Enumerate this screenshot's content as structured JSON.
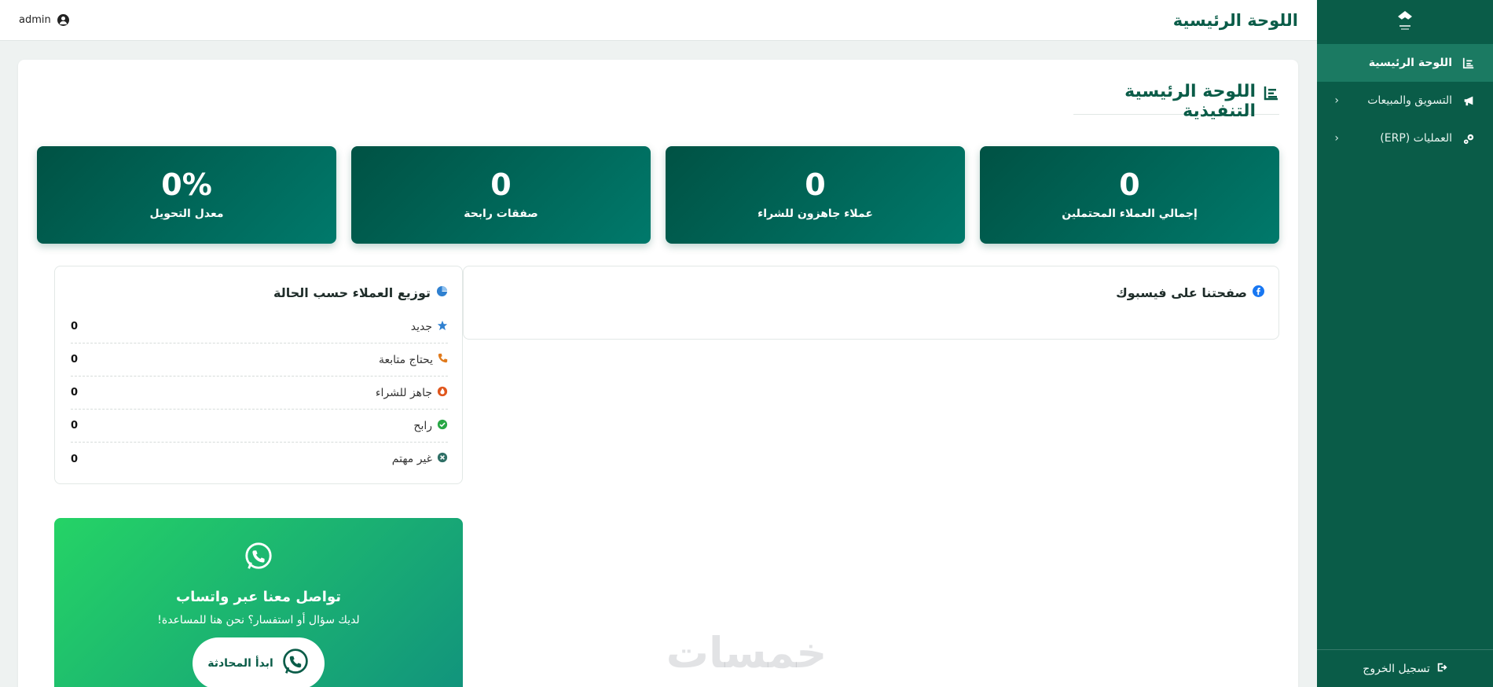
{
  "sidebar": {
    "items": [
      {
        "label": "اللوحة الرئيسية",
        "icon": "chart-icon",
        "active": true
      },
      {
        "label": "التسويق والمبيعات",
        "icon": "megaphone-icon"
      },
      {
        "label": "العمليات (ERP)",
        "icon": "gears-icon"
      }
    ],
    "logout_label": "تسجيل الخروج"
  },
  "header": {
    "title": "اللوحة الرئيسية",
    "user": "admin"
  },
  "main": {
    "section_title": "اللوحة الرئيسية التنفيذية",
    "stats": [
      {
        "value": "0",
        "label": "إجمالي العملاء المحتملين"
      },
      {
        "value": "0",
        "label": "عملاء جاهزون للشراء"
      },
      {
        "value": "0",
        "label": "صفقات رابحة"
      },
      {
        "value": "0%",
        "label": "معدل التحويل"
      }
    ],
    "facebook": {
      "title": "صفحتنا على فيسبوك"
    },
    "distribution": {
      "title": "توزيع العملاء حسب الحالة",
      "rows": [
        {
          "label": "جديد",
          "count": "0",
          "icon": "star-icon",
          "color": "#2f80d0"
        },
        {
          "label": "يحتاج متابعة",
          "count": "0",
          "icon": "phone-icon",
          "color": "#e07a1c"
        },
        {
          "label": "جاهز للشراء",
          "count": "0",
          "icon": "fire-icon",
          "color": "#e0561c"
        },
        {
          "label": "رابح",
          "count": "0",
          "icon": "check-circle-icon",
          "color": "#28a745"
        },
        {
          "label": "غير مهتم",
          "count": "0",
          "icon": "x-circle-icon",
          "color": "#2f6f66"
        }
      ]
    },
    "whatsapp": {
      "title": "تواصل معنا عبر واتساب",
      "subtitle": "لديك سؤال أو استفسار؟ نحن هنا للمساعدة!",
      "button_label": "ابدأ المحادثة"
    }
  },
  "watermark": "خمسات",
  "colors": {
    "primary": "#0a5c48",
    "accent": "#1b7a62",
    "whatsapp": "#25d366"
  }
}
